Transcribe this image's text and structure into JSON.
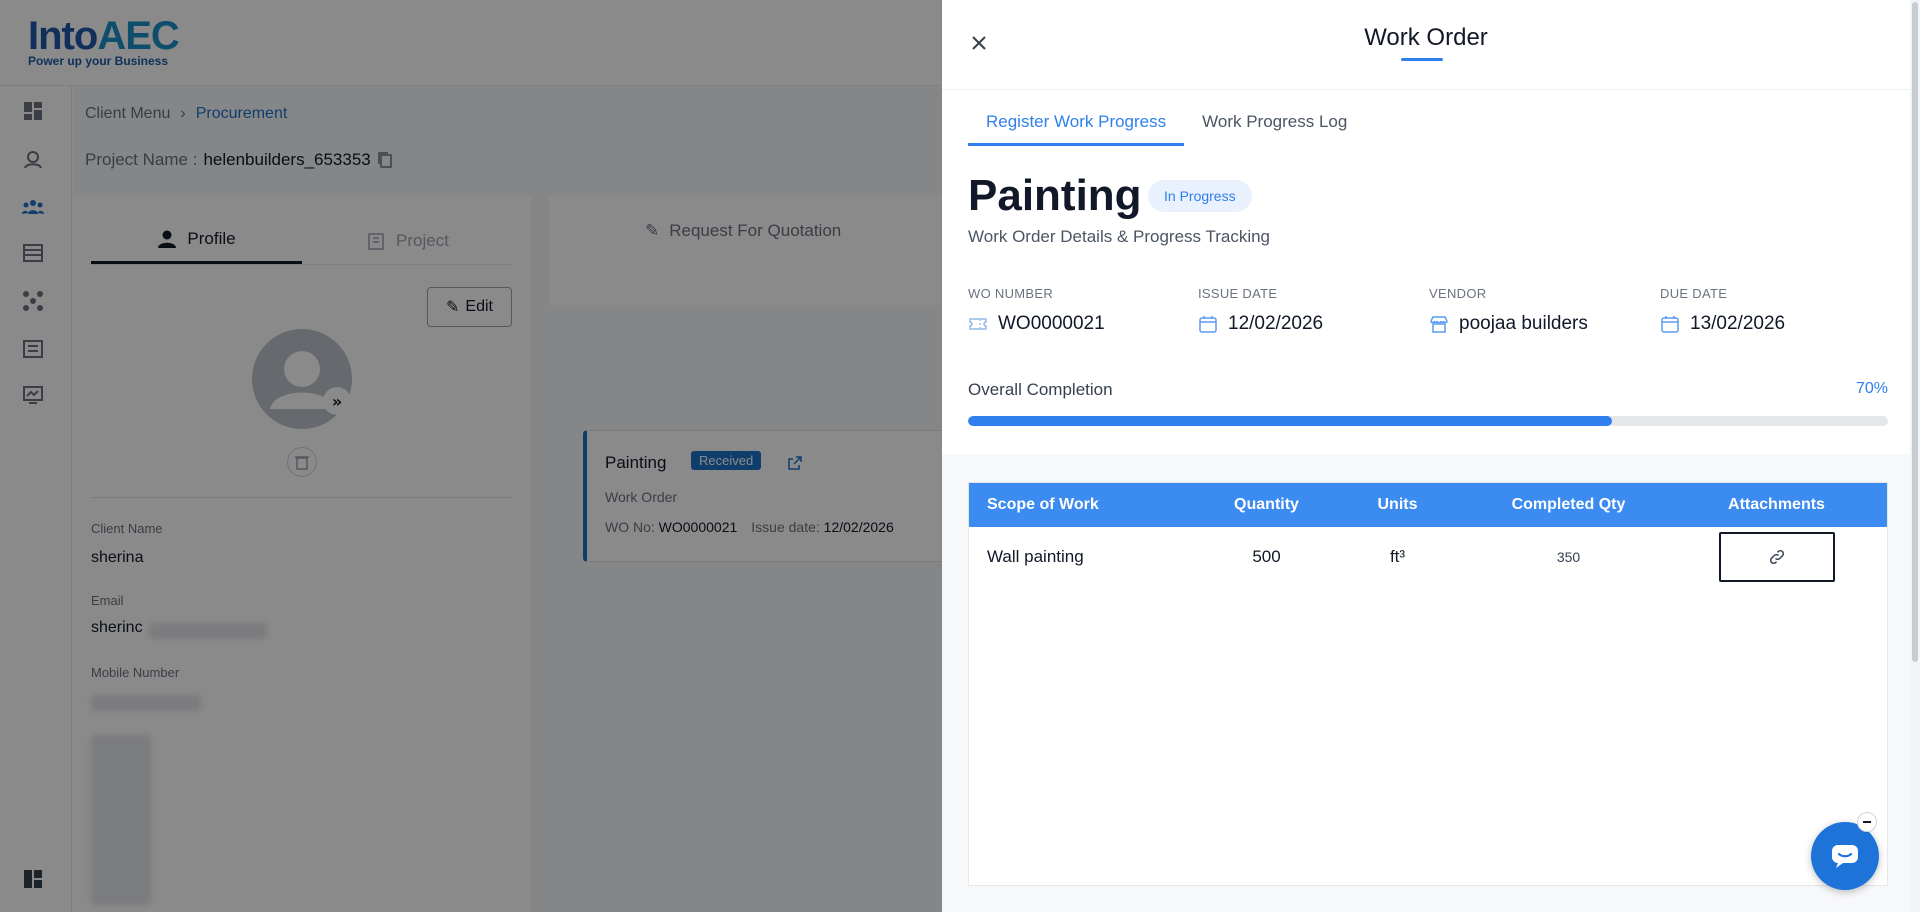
{
  "brand": {
    "logo_main": "Into",
    "logo_accent": "AEC",
    "tagline": "Power up your Business",
    "primary": "#2f80ed",
    "header_blue": "#3b8bf0"
  },
  "background": {
    "breadcrumb": [
      "Client Menu",
      "Procurement"
    ],
    "project_label": "Project Name :",
    "project_value": "helenbuilders_653353",
    "tabs": [
      "Profile",
      "Project"
    ],
    "edit_label": "Edit",
    "rfq_tab": "Request For Quotation",
    "fields": {
      "client_name_label": "Client Name",
      "client_name_value": "sherina",
      "email_label": "Email",
      "email_value": "sherinc",
      "mobile_label": "Mobile Number"
    },
    "wo_card": {
      "title": "Painting",
      "badge": "Received",
      "subtitle": "Work Order",
      "wo_label": "WO No:",
      "wo_value": "WO0000021",
      "issue_label": "Issue date:",
      "issue_value": "12/02/2026"
    }
  },
  "drawer": {
    "title": "Work Order",
    "tabs": [
      {
        "label": "Register Work Progress",
        "active": true
      },
      {
        "label": "Work Progress Log",
        "active": false
      }
    ],
    "work_order": {
      "name": "Painting",
      "status": "In Progress",
      "subtitle": "Work Order Details & Progress Tracking"
    },
    "info": {
      "wo_number_label": "WO NUMBER",
      "wo_number": "WO0000021",
      "issue_date_label": "ISSUE DATE",
      "issue_date": "12/02/2026",
      "vendor_label": "VENDOR",
      "vendor": "poojaa builders",
      "due_date_label": "DUE DATE",
      "due_date": "13/02/2026"
    },
    "completion": {
      "label": "Overall Completion",
      "percent_text": "70%",
      "percent": 70
    },
    "table": {
      "headers": [
        "Scope of Work",
        "Quantity",
        "Units",
        "Completed Qty",
        "Attachments"
      ],
      "rows": [
        {
          "scope": "Wall painting",
          "quantity": "500",
          "units": "ft³",
          "completed": "350"
        }
      ]
    }
  }
}
